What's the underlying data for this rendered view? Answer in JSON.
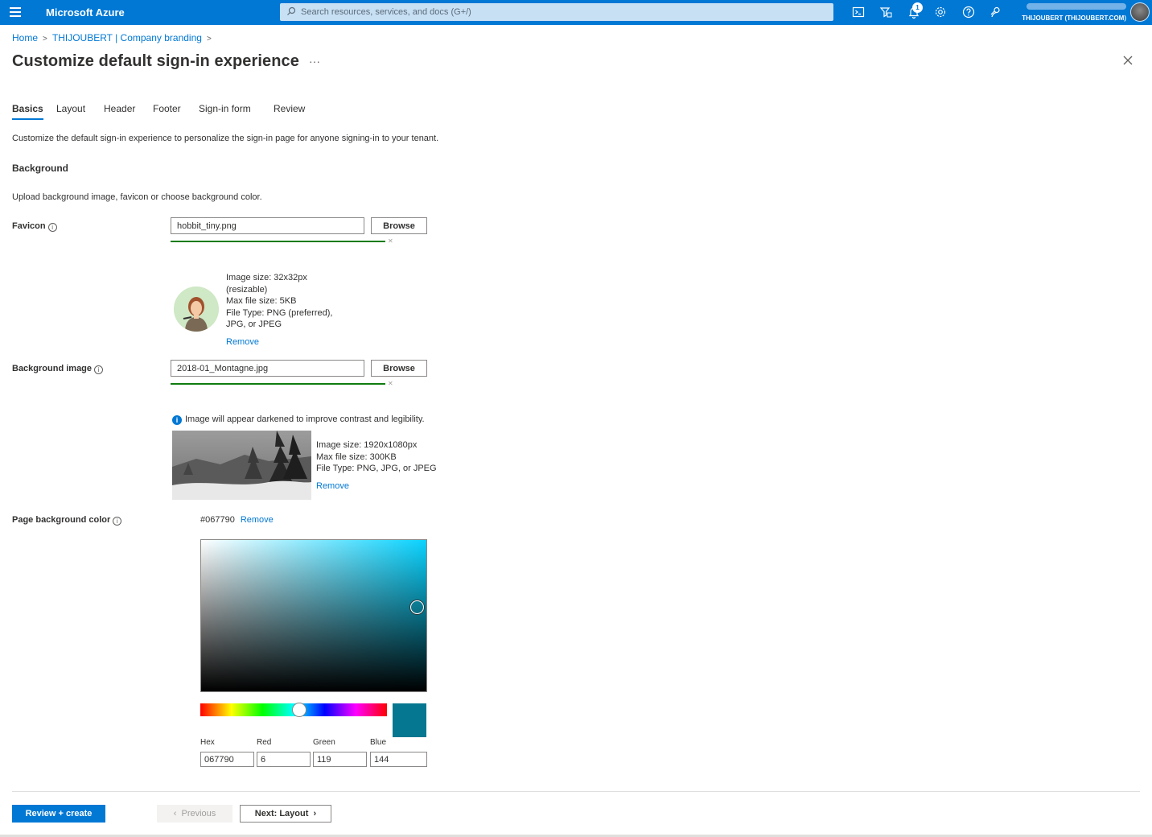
{
  "topbar": {
    "brand": "Microsoft Azure",
    "search_placeholder": "Search resources, services, and docs (G+/)",
    "notification_count": "1",
    "tenant": "THIJOUBERT (THIJOUBERT.COM)",
    "icons": [
      "cloud-shell-icon",
      "directory-filter-icon",
      "notifications-icon",
      "settings-icon",
      "help-icon",
      "feedback-icon"
    ]
  },
  "breadcrumb": [
    "Home",
    "THIJOUBERT | Company branding"
  ],
  "page": {
    "title": "Customize default sign-in experience",
    "more": "···"
  },
  "tabs": [
    "Basics",
    "Layout",
    "Header",
    "Footer",
    "Sign-in form",
    "Review"
  ],
  "description": "Customize the default sign-in experience to personalize the sign-in page for anyone signing-in to your tenant.",
  "background": {
    "heading": "Background",
    "description": "Upload background image, favicon or choose background color."
  },
  "favicon": {
    "label": "Favicon",
    "file": "hobbit_tiny.png",
    "browse": "Browse",
    "meta": [
      "Image size: 32x32px",
      "(resizable)",
      "Max file size: 5KB",
      "File Type: PNG (preferred),",
      "JPG, or JPEG"
    ],
    "remove": "Remove"
  },
  "background_image": {
    "label": "Background image",
    "file": "2018-01_Montagne.jpg",
    "browse": "Browse",
    "note": "Image will appear darkened to improve contrast and legibility.",
    "meta": [
      "Image size: 1920x1080px",
      "Max file size: 300KB",
      "File Type: PNG, JPG, or JPEG"
    ],
    "remove": "Remove"
  },
  "page_color": {
    "label": "Page background color",
    "value": "#067790",
    "remove": "Remove",
    "swatch_color": "#067790",
    "hue_color": "#0ad3ff",
    "fields": {
      "hex_label": "Hex",
      "hex": "067790",
      "red_label": "Red",
      "red": "6",
      "green_label": "Green",
      "green": "119",
      "blue_label": "Blue",
      "blue": "144"
    }
  },
  "footer": {
    "review_create": "Review + create",
    "previous": "Previous",
    "next": "Next: Layout"
  }
}
